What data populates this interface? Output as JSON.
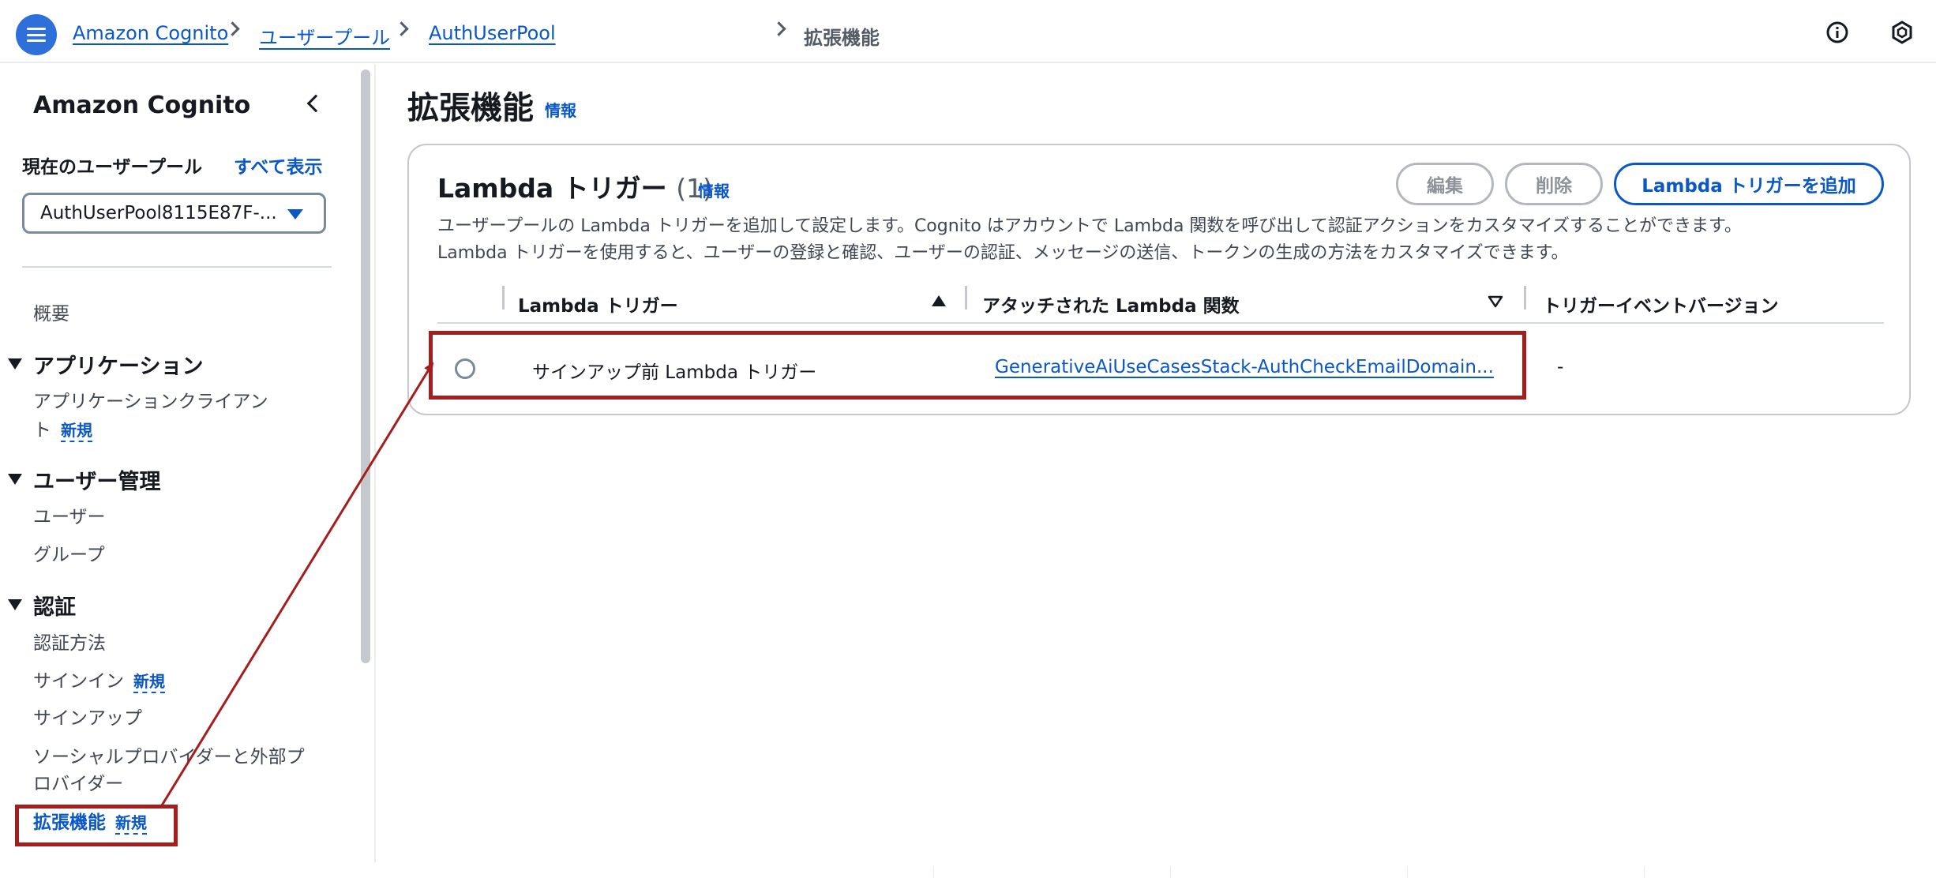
{
  "breadcrumb": {
    "items": [
      "Amazon Cognito",
      "ユーザープール",
      "AuthUserPool"
    ],
    "current": "拡張機能"
  },
  "header": {
    "menu_icon": "hamburger-menu-icon",
    "info_icon": "info-circle-icon",
    "settings_icon": "hexagon-gear-icon"
  },
  "sidebar": {
    "title": "Amazon Cognito",
    "current_pool_label": "現在のユーザープール",
    "show_all": "すべて表示",
    "pool_selected": "AuthUserPool8115E87F-...",
    "overview": "概要",
    "sections": [
      {
        "title": "アプリケーション",
        "items": [
          {
            "label": "アプリケーションクライアン",
            "label2": "ト",
            "badge": "新規"
          }
        ]
      },
      {
        "title": "ユーザー管理",
        "items": [
          {
            "label": "ユーザー"
          },
          {
            "label": "グループ"
          }
        ]
      },
      {
        "title": "認証",
        "items": [
          {
            "label": "認証方法"
          },
          {
            "label": "サインイン",
            "badge": "新規"
          },
          {
            "label": "サインアップ"
          },
          {
            "label": "ソーシャルプロバイダーと外部プ",
            "label2": "ロバイダー"
          },
          {
            "label": "拡張機能",
            "badge": "新規",
            "active": true
          }
        ]
      }
    ]
  },
  "main": {
    "title": "拡張機能",
    "info": "情報",
    "panel": {
      "title": "Lambda トリガー",
      "count": "(1)",
      "info": "情報",
      "buttons": {
        "edit": "編集",
        "delete": "削除",
        "add": "Lambda トリガーを追加"
      },
      "description_line1": "ユーザープールの Lambda トリガーを追加して設定します。Cognito はアカウントで Lambda 関数を呼び出して認証アクションをカスタマイズすることができます。",
      "description_line2": "Lambda トリガーを使用すると、ユーザーの登録と確認、ユーザーの認証、メッセージの送信、トークンの生成の方法をカスタマイズできます。",
      "columns": [
        "Lambda トリガー",
        "アタッチされた Lambda 関数",
        "トリガーイベントバージョン"
      ],
      "rows": [
        {
          "trigger": "サインアップ前 Lambda トリガー",
          "function": "GenerativeAiUseCasesStack-AuthCheckEmailDomain...",
          "version": "-"
        }
      ]
    }
  },
  "colors": {
    "accent": "#0a58c8",
    "annotation": "#a51d1d",
    "menu": "#2f6fd9"
  }
}
